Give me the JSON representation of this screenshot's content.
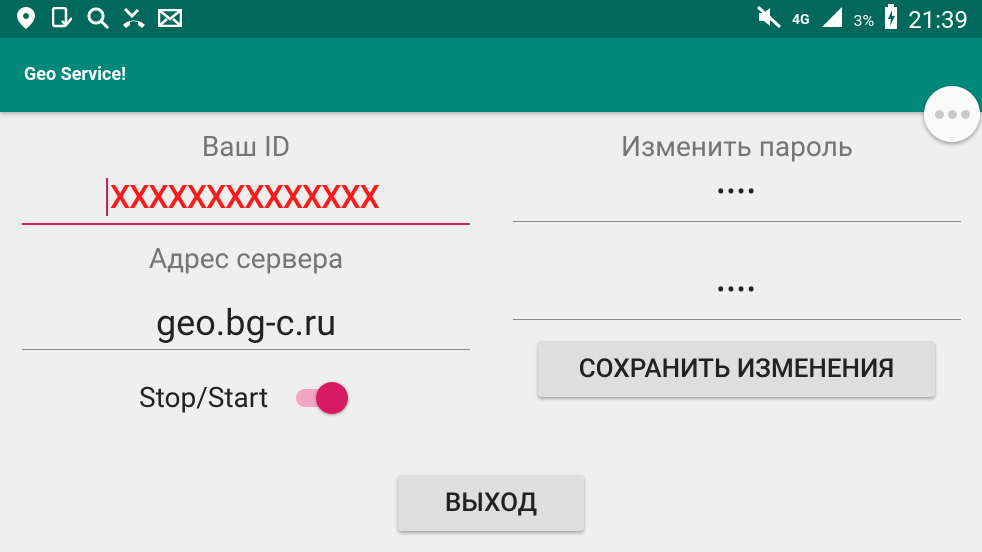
{
  "status_bar": {
    "icons_left": [
      "location-icon",
      "sim-icon",
      "search-icon",
      "missed-call-icon",
      "mail-icon"
    ],
    "network": "4G",
    "battery_percent": "3%",
    "time": "21:39"
  },
  "app_bar": {
    "title": "Geo Service!"
  },
  "left_panel": {
    "id_label": "Ваш ID",
    "id_value": "XXXXXXXXXXXXXX",
    "server_label": "Адрес сервера",
    "server_value": "geo.bg-c.ru",
    "toggle_label": "Stop/Start",
    "toggle_on": true
  },
  "right_panel": {
    "password_label": "Изменить пароль",
    "password_value": "••••",
    "password_confirm_value": "••••",
    "save_button": "СОХРАНИТЬ ИЗМЕНЕНИЯ"
  },
  "exit_button": "ВЫХОД",
  "colors": {
    "status_bar": "#00695c",
    "app_bar": "#00897b",
    "accent": "#d81b60",
    "id_text": "#ff1a1a"
  }
}
